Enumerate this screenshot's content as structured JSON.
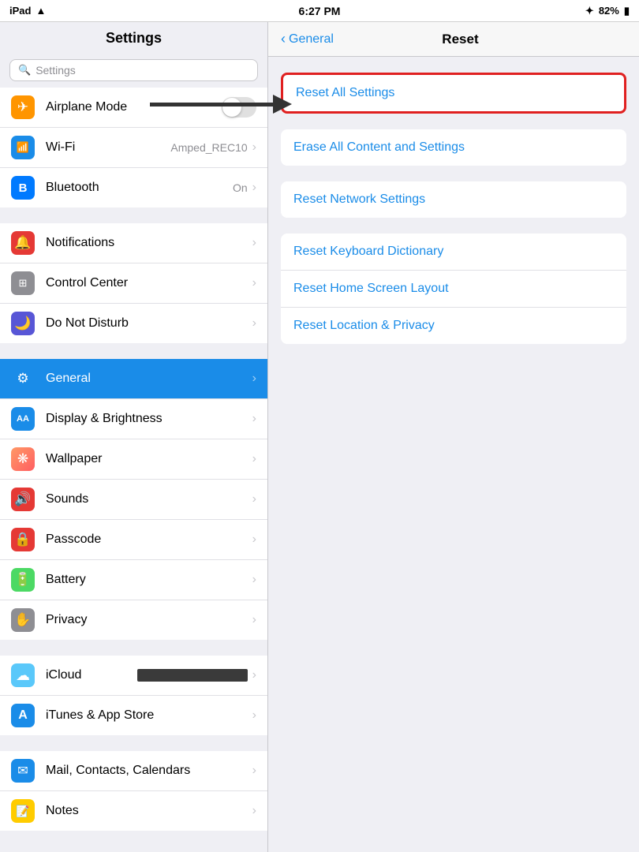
{
  "statusBar": {
    "left": "iPad",
    "wifi": "wifi",
    "time": "6:27 PM",
    "bluetooth": "bluetooth",
    "battery": "82%"
  },
  "sidebar": {
    "title": "Settings",
    "searchPlaceholder": "Settings",
    "items": [
      {
        "id": "airplane-mode",
        "label": "Airplane Mode",
        "icon": "✈",
        "iconClass": "icon-orange",
        "hasToggle": true,
        "toggleOn": false
      },
      {
        "id": "wifi",
        "label": "Wi-Fi",
        "icon": "📶",
        "iconClass": "icon-blue2",
        "value": "Amped_REC10",
        "hasToggle": false
      },
      {
        "id": "bluetooth",
        "label": "Bluetooth",
        "icon": "B",
        "iconClass": "icon-blue",
        "value": "On",
        "hasToggle": false
      },
      {
        "id": "notifications",
        "label": "Notifications",
        "icon": "🔔",
        "iconClass": "icon-red",
        "hasToggle": false
      },
      {
        "id": "control-center",
        "label": "Control Center",
        "icon": "⊞",
        "iconClass": "icon-gray",
        "hasToggle": false
      },
      {
        "id": "do-not-disturb",
        "label": "Do Not Disturb",
        "icon": "🌙",
        "iconClass": "icon-purple",
        "hasToggle": false
      },
      {
        "id": "general",
        "label": "General",
        "icon": "⚙",
        "iconClass": "icon-blue-general",
        "active": true,
        "hasToggle": false
      },
      {
        "id": "display-brightness",
        "label": "Display & Brightness",
        "icon": "AA",
        "iconClass": "icon-blue2",
        "hasToggle": false
      },
      {
        "id": "wallpaper",
        "label": "Wallpaper",
        "icon": "❋",
        "iconClass": "icon-wallpaper",
        "hasToggle": false
      },
      {
        "id": "sounds",
        "label": "Sounds",
        "icon": "🔊",
        "iconClass": "icon-sounds",
        "hasToggle": false
      },
      {
        "id": "passcode",
        "label": "Passcode",
        "icon": "🔒",
        "iconClass": "icon-passcode",
        "hasToggle": false
      },
      {
        "id": "battery",
        "label": "Battery",
        "icon": "🔋",
        "iconClass": "icon-battery",
        "hasToggle": false
      },
      {
        "id": "privacy",
        "label": "Privacy",
        "icon": "✋",
        "iconClass": "icon-privacy",
        "hasToggle": false
      },
      {
        "id": "icloud",
        "label": "iCloud",
        "icon": "☁",
        "iconClass": "icon-cloud",
        "hasToggle": false,
        "redacted": true
      },
      {
        "id": "itunes-app-store",
        "label": "iTunes & App Store",
        "icon": "A",
        "iconClass": "icon-appstore",
        "hasToggle": false
      },
      {
        "id": "mail-contacts-calendars",
        "label": "Mail, Contacts, Calendars",
        "icon": "✉",
        "iconClass": "icon-mail",
        "hasToggle": false
      },
      {
        "id": "notes",
        "label": "Notes",
        "icon": "📝",
        "iconClass": "icon-notes",
        "hasToggle": false
      }
    ]
  },
  "rightPanel": {
    "backLabel": "General",
    "title": "Reset",
    "resetItems": {
      "resetAllSettings": "Reset All Settings",
      "eraseAllContent": "Erase All Content and Settings",
      "resetNetworkSettings": "Reset Network Settings",
      "resetKeyboardDictionary": "Reset Keyboard Dictionary",
      "resetHomeScreenLayout": "Reset Home Screen Layout",
      "resetLocationPrivacy": "Reset Location & Privacy"
    }
  }
}
